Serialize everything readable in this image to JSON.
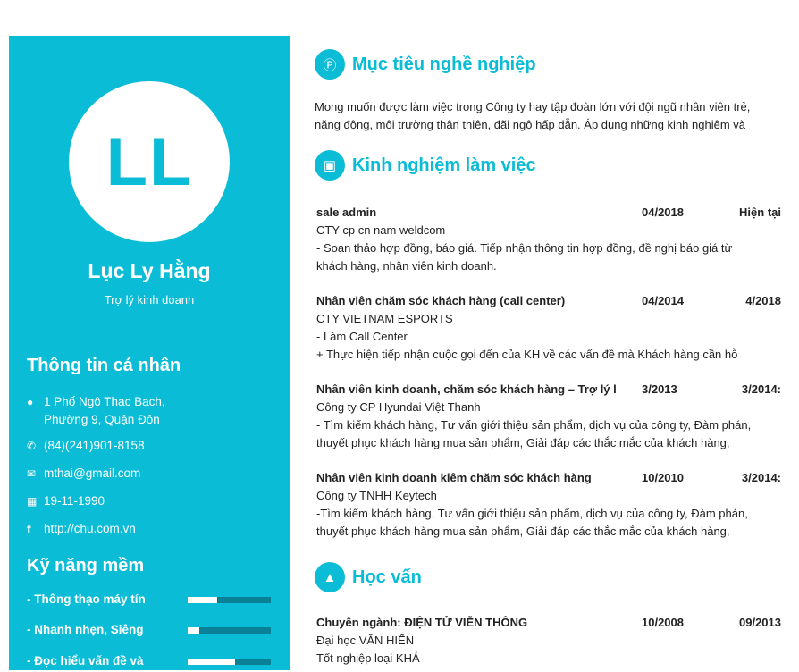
{
  "accent": "#0bbcd6",
  "profile": {
    "initials": "LL",
    "name": "Lục Ly Hằng",
    "role": "Trợ lý kinh doanh"
  },
  "personal": {
    "title": "Thông tin cá nhân",
    "address": [
      "1 Phố Ngô Thạc Bạch,",
      "Phường 9, Quận Đôn"
    ],
    "phone": "(84)(241)901-8158",
    "email": "mthai@gmail.com",
    "birthday": "19-11-1990",
    "website": "http://chu.com.vn"
  },
  "skills": {
    "title": "Kỹ năng mềm",
    "items": [
      {
        "label": "- Thông thạo máy tín",
        "level": 0.35
      },
      {
        "label": "- Nhanh nhẹn, Siêng",
        "level": 0.14
      },
      {
        "label": "- Đọc hiểu vấn đề và",
        "level": 0.57
      }
    ]
  },
  "objective": {
    "title": "Mục tiêu nghề nghiệp",
    "icon": "pinterest-icon",
    "lines": [
      "Mong muốn được làm việc trong Công ty hay tập đoàn lớn với đội ngũ nhân viên trẻ,",
      "năng động, môi trường thân thiện, đãi ngộ hấp dẫn. Áp dụng những kinh nghiệm và"
    ]
  },
  "experience": {
    "title": "Kinh nghiệm làm việc",
    "icon": "briefcase-icon",
    "jobs": [
      {
        "title": "sale admin",
        "start": "04/2018",
        "end": "Hiện tại",
        "company": "CTY cp cn nam weldcom",
        "lines": [
          "- Soạn thảo hợp đồng, báo giá. Tiếp nhận thông tin hợp đồng, đề nghị báo giá từ",
          "khách hàng, nhân viên kinh doanh."
        ]
      },
      {
        "title": "Nhân viên chăm sóc khách hàng (call center)",
        "start": "04/2014",
        "end": "4/2018",
        "company": "CTY VIETNAM ESPORTS",
        "lines": [
          "- Làm Call Center",
          "+ Thực hiện tiếp nhận cuộc gọi đến của KH về các vấn đề mà Khách hàng cần hỗ"
        ]
      },
      {
        "title": "Nhân viên kinh doanh, chăm sóc khách hàng – Trợ lý l",
        "start": "3/2013",
        "end": "3/2014:",
        "company": "Công ty CP Hyundai Việt Thanh",
        "lines": [
          "- Tìm kiếm khách hàng, Tư vấn giới thiệu sản phẩm, dịch vụ của công ty, Đàm phán,",
          "thuyết phục khách hàng mua sản phẩm, Giải đáp các thắc mắc của khách hàng,"
        ]
      },
      {
        "title": "Nhân viên kinh doanh kiêm chăm sóc khách hàng",
        "start": "10/2010",
        "end": "3/2014:",
        "company": "Công ty TNHH Keytech",
        "lines": [
          "-Tìm kiếm khách hàng, Tư vấn giới thiệu sản phẩm, dịch vụ của công ty, Đàm phán,",
          "thuyết phục khách hàng mua sản phẩm, Giải đáp các thắc mắc của khách hàng,"
        ]
      }
    ]
  },
  "education": {
    "title": "Học vấn",
    "icon": "graduation-cap-icon",
    "items": [
      {
        "title": "Chuyên ngành: ĐIỆN TỬ VIỄN THÔNG",
        "start": "10/2008",
        "end": "09/2013",
        "school": "Đại học VĂN HIẾN",
        "grade": "Tốt nghiệp loại KHÁ"
      }
    ]
  }
}
